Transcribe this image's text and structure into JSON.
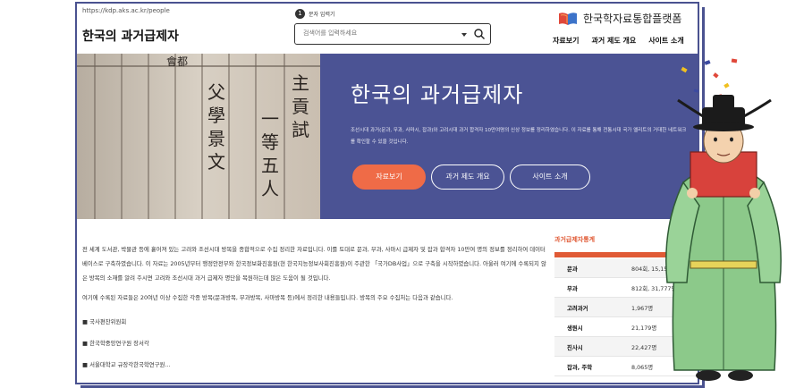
{
  "header": {
    "url": "https://kdp.aks.ac.kr/people",
    "site_title": "한국의 과거급제자",
    "step_number": "1",
    "step_label": "문자 입력기",
    "search_placeholder": "검색어를 입력하세요",
    "platform_name": "한국학자료통합플랫폼",
    "nav": [
      "자료보기",
      "과거 제도 개요",
      "사이트 소개"
    ]
  },
  "hero": {
    "title": "한국의 과거급제자",
    "description": "조선시대 과거(문과, 무과, 사마시, 잡과)와 고려시대 과거 합격자 10만여명의 신상 정보를 정리하였습니다. 이 자료를 통해 전통시대 국가 엘리트의 거대한 네트워크를 확인할 수 있을 것입니다.",
    "buttons": [
      "자료보기",
      "과거 제도 개요",
      "사이트 소개"
    ]
  },
  "content": {
    "paragraph1": "전 세계 도서관, 박물관 등에 흩어져 있는 고려와 조선시대 방목을 종합적으로 수집 정리한 자료입니다. 이를 토대로 문과, 무과, 사마시 급제자 및 잡과 합격자 10만여 명의 정보를 정리하여 데이터베이스로 구축하였습니다. 이 자료는 2005년부터 행정안전부와 한국정보화진흥원(현 한국지능정보사회진흥원)이 주관한 「국가DB사업」으로 구축을 시작하였습니다. 아울러 여기에 수록되지 않은 방목의 소재를 알려 주시면 고려와 조선시대 과거 급제자 명단을 복원하는데 많은 도움이 될 것입니다.",
    "paragraph2": "여기에 수록된 자료들은 20여년 이상 수집한 각종 방목(문과방목, 무과방목, 사마방목 등)에서 정리한 내용들입니다. 방목의 주요 수집처는 다음과 같습니다.",
    "bullets": [
      "■ 국사편찬위원회",
      "■ 한국학중앙연구원 장서각",
      "■ 서울대학교 규장각한국학연구원..."
    ]
  },
  "stats": {
    "title": "과거급제자통계",
    "rows": [
      {
        "label": "문과",
        "value": "804회, 15,151명"
      },
      {
        "label": "무과",
        "value": "812회, 31,777명"
      },
      {
        "label": "고려과거",
        "value": "1,967명"
      },
      {
        "label": "생원시",
        "value": "21,179명"
      },
      {
        "label": "진사시",
        "value": "22,427명"
      },
      {
        "label": "잡과, 주학",
        "value": "8,065명"
      }
    ]
  },
  "photo_chars": [
    "會都",
    "主",
    "貢",
    "試",
    "一",
    "等",
    "五",
    "人",
    "父",
    "學",
    "景",
    "文"
  ],
  "colors": {
    "hero_bg": "#4b5394",
    "accent": "#ef6b47",
    "frame": "#4a5290"
  }
}
